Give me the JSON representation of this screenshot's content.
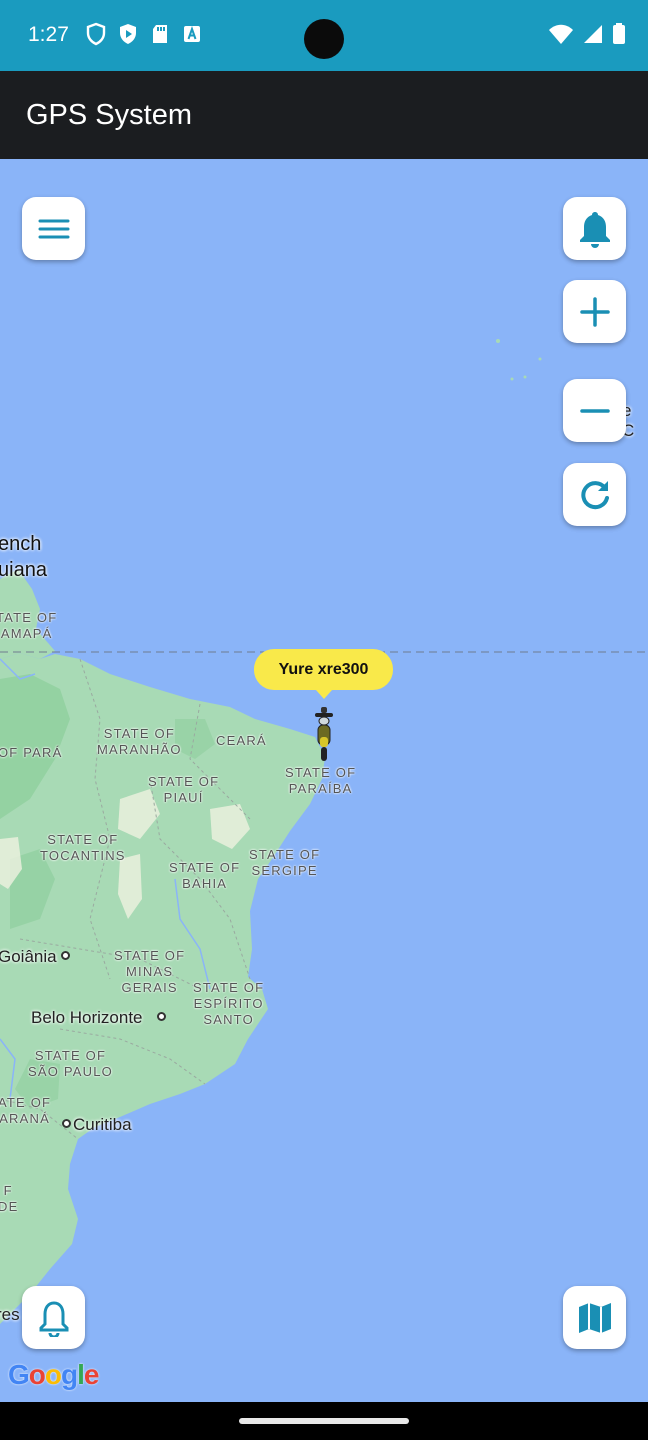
{
  "status_bar": {
    "time": "1:27",
    "left_icons": [
      "shield-icon",
      "play-protect-icon",
      "sd-card-icon",
      "font-a-icon"
    ],
    "right_icons": [
      "wifi-icon",
      "signal-icon",
      "battery-icon"
    ],
    "background": "#1a9bbf"
  },
  "app_bar": {
    "title": "GPS System",
    "background": "#1b1d20"
  },
  "map": {
    "water_color": "#8ab4f8",
    "land_color": "#a8dab5",
    "labels": {
      "french_guiana_1": "ench",
      "french_guiana_2": "uiana",
      "amapa_1": "TATE OF",
      "amapa_2": "AMAPÁ",
      "para": "OF PARÁ",
      "maranhao_1": "STATE OF",
      "maranhao_2": "MARANHÃO",
      "ceara": "CEARÁ",
      "paraiba_1": "STATE OF",
      "paraiba_2": "PARAÍBA",
      "piaui_1": "STATE OF",
      "piaui_2": "PIAUÍ",
      "tocantins_1": "STATE OF",
      "tocantins_2": "TOCANTINS",
      "bahia_1": "STATE OF",
      "bahia_2": "BAHIA",
      "sergipe_1": "STATE OF",
      "sergipe_2": "SERGIPE",
      "goiania": "Goiânia",
      "minas_1": "STATE OF",
      "minas_2": "MINAS",
      "minas_3": "GERAIS",
      "espirito_1": "STATE OF",
      "espirito_2": "ESPÍRITO",
      "espirito_3": "SANTO",
      "belo_horizonte": "Belo Horizonte",
      "sao_paulo_1": "STATE OF",
      "sao_paulo_2": "SÃO PAULO",
      "parana_1": "ATE OF",
      "parana_2": "ARANÁ",
      "curitiba": "Curitiba",
      "south_1": "F",
      "south_2": "DE",
      "edge_res": "res",
      "edge_east": "e C"
    },
    "google_logo": "Google"
  },
  "marker": {
    "label": "Yure xre300",
    "bubble_color": "#f9e94a"
  },
  "controls": {
    "menu": "menu-icon",
    "notifications": "bell-icon",
    "zoom_in": "plus-icon",
    "zoom_out": "minus-icon",
    "refresh": "refresh-icon",
    "alerts_outline": "bell-outline-icon",
    "map_type": "map-icon",
    "accent": "#1a8fb4"
  }
}
